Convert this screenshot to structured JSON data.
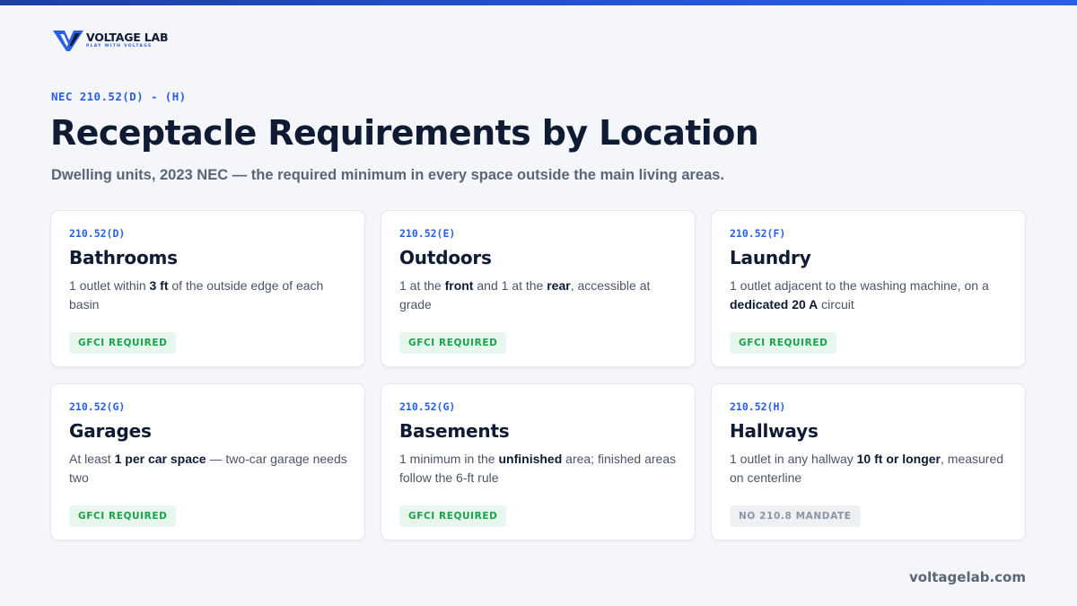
{
  "brand": {
    "name": "VOLTAGE LAB",
    "tagline": "PLAY WITH VOLTAGE",
    "accent_color": "#2a5fe6",
    "logo_icon": "voltage-lab-logo-icon"
  },
  "header": {
    "eyebrow": "NEC 210.52(D) - (H)",
    "title": "Receptacle Requirements by Location",
    "subtitle": "Dwelling units, 2023 NEC — the required minimum in every space outside the main living areas."
  },
  "cards": [
    {
      "code": "210.52(D)",
      "title": "Bathrooms",
      "desc": [
        {
          "t": "1 outlet within "
        },
        {
          "t": "3 ft",
          "b": true
        },
        {
          "t": " of the outside edge of each basin"
        }
      ],
      "badge": "GFCI REQUIRED",
      "badge_type": "gfci"
    },
    {
      "code": "210.52(E)",
      "title": "Outdoors",
      "desc": [
        {
          "t": "1 at the "
        },
        {
          "t": "front",
          "b": true
        },
        {
          "t": " and 1 at the "
        },
        {
          "t": "rear",
          "b": true
        },
        {
          "t": ", accessible at grade"
        }
      ],
      "badge": "GFCI REQUIRED",
      "badge_type": "gfci"
    },
    {
      "code": "210.52(F)",
      "title": "Laundry",
      "desc": [
        {
          "t": "1 outlet adjacent to the washing machine, on a "
        },
        {
          "t": "dedicated 20 A",
          "b": true
        },
        {
          "t": " circuit"
        }
      ],
      "badge": "GFCI REQUIRED",
      "badge_type": "gfci"
    },
    {
      "code": "210.52(G)",
      "title": "Garages",
      "desc": [
        {
          "t": "At least "
        },
        {
          "t": "1 per car space",
          "b": true
        },
        {
          "t": " — two-car garage needs two"
        }
      ],
      "badge": "GFCI REQUIRED",
      "badge_type": "gfci"
    },
    {
      "code": "210.52(G)",
      "title": "Basements",
      "desc": [
        {
          "t": "1 minimum in the "
        },
        {
          "t": "unfinished",
          "b": true
        },
        {
          "t": " area; finished areas follow the 6-ft rule"
        }
      ],
      "badge": "GFCI REQUIRED",
      "badge_type": "gfci"
    },
    {
      "code": "210.52(H)",
      "title": "Hallways",
      "desc": [
        {
          "t": "1 outlet in any hallway "
        },
        {
          "t": "10 ft or longer",
          "b": true
        },
        {
          "t": ", measured on centerline"
        }
      ],
      "badge": "NO 210.8 MANDATE",
      "badge_type": "none"
    }
  ],
  "footer": {
    "site": "voltagelab.com"
  }
}
